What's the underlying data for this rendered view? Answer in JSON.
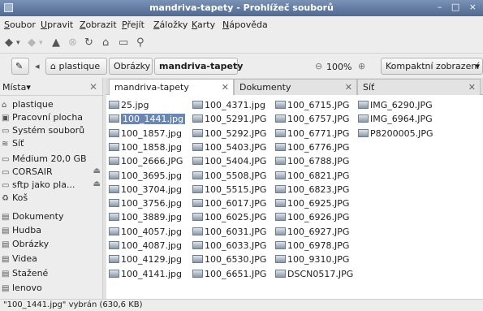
{
  "window": {
    "title": "mandriva-tapety - Prohlížeč souborů",
    "controls": "– □ ×"
  },
  "menu": [
    "Soubor",
    "Upravit",
    "Zobrazit",
    "Přejít",
    "Záložky",
    "Karty",
    "Nápověda"
  ],
  "toolbar": {
    "back_icon": "◆",
    "back_arrow": "▾",
    "forward_icon": "◆",
    "forward_arrow": "▾",
    "up_icon": "▲",
    "stop_icon": "⊗",
    "reload_icon": "↻",
    "home_icon": "⌂",
    "computer_icon": "▭",
    "search_icon": "⚲"
  },
  "location": {
    "toggle_icon": "✎",
    "prev_arrow": "◂",
    "home_icon": "⌂",
    "crumbs": [
      "plastique",
      "Obrázky",
      "mandriva-tapety"
    ],
    "zoom_out_icon": "⊖",
    "zoom": "100%",
    "zoom_in_icon": "⊕",
    "view_mode": "Kompaktní zobrazení"
  },
  "sidebar": {
    "header": "Místa▾",
    "close": "✕",
    "items": [
      {
        "icon": "⌂",
        "label": "plastique"
      },
      {
        "icon": "▣",
        "label": "Pracovní plocha"
      },
      {
        "icon": "▭",
        "label": "Systém souborů"
      },
      {
        "icon": "≋",
        "label": "Síť"
      },
      {
        "icon": "▭",
        "label": "Médium 20,0 GB"
      },
      {
        "icon": "▭",
        "label": "CORSAIR",
        "eject": "⏏"
      },
      {
        "icon": "▭",
        "label": "sftp jako pla...",
        "eject": "⏏"
      },
      {
        "icon": "♻",
        "label": "Koš"
      },
      {
        "icon": "▤",
        "label": "Dokumenty"
      },
      {
        "icon": "▤",
        "label": "Hudba"
      },
      {
        "icon": "▤",
        "label": "Obrázky"
      },
      {
        "icon": "▤",
        "label": "Videa"
      },
      {
        "icon": "▤",
        "label": "Stažené"
      },
      {
        "icon": "▤",
        "label": "lenovo"
      }
    ]
  },
  "tabs": [
    {
      "label": "mandriva-tapety",
      "close": "✕"
    },
    {
      "label": "Dokumenty",
      "close": "✕"
    },
    {
      "label": "Síť",
      "close": "✕"
    }
  ],
  "files": {
    "columns": [
      [
        "25.jpg",
        "100_1441.jpg",
        "100_1857.jpg",
        "100_1858.jpg",
        "100_2666.JPG",
        "100_3695.jpg",
        "100_3704.jpg",
        "100_3756.jpg",
        "100_3889.jpg",
        "100_4057.jpg",
        "100_4087.jpg",
        "100_4129.jpg",
        "100_4141.jpg"
      ],
      [
        "100_4371.jpg",
        "100_5291.JPG",
        "100_5292.JPG",
        "100_5403.JPG",
        "100_5404.JPG",
        "100_5508.JPG",
        "100_5515.JPG",
        "100_6017.JPG",
        "100_6025.JPG",
        "100_6031.JPG",
        "100_6033.JPG",
        "100_6530.JPG",
        "100_6651.JPG"
      ],
      [
        "100_6715.JPG",
        "100_6757.JPG",
        "100_6771.JPG",
        "100_6776.JPG",
        "100_6788.JPG",
        "100_6821.JPG",
        "100_6823.JPG",
        "100_6925.JPG",
        "100_6926.JPG",
        "100_6927.JPG",
        "100_6978.JPG",
        "100_9310.JPG",
        "DSCN0517.JPG"
      ],
      [
        "IMG_6290.JPG",
        "IMG_6964.JPG",
        "P8200005.JPG"
      ]
    ],
    "selected": "100_1441.jpg"
  },
  "status": "\"100_1441.jpg\" vybrán (630,6 KB)"
}
